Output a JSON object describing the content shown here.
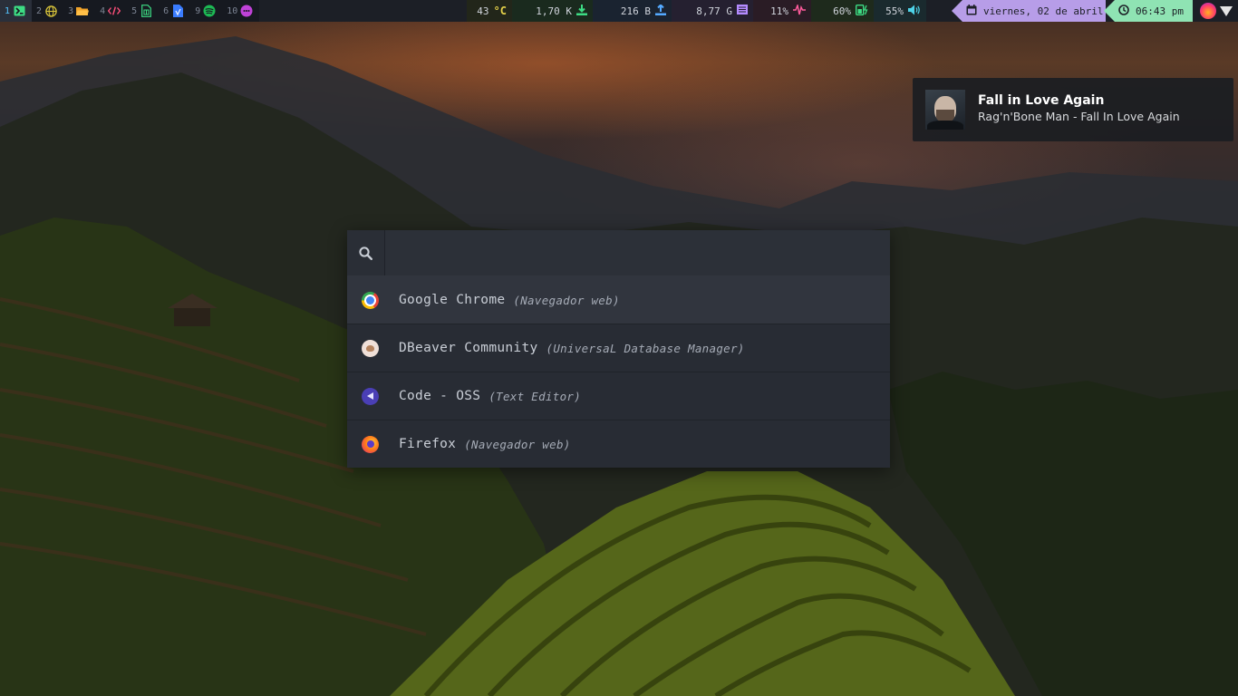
{
  "topbar": {
    "workspaces": [
      {
        "num": "1",
        "icon": "terminal-icon",
        "color": "#3ddc84",
        "active": true
      },
      {
        "num": "2",
        "icon": "globe-icon",
        "color": "#d6c23a"
      },
      {
        "num": "3",
        "icon": "folder-icon",
        "color": "#f0a32a"
      },
      {
        "num": "4",
        "icon": "code-icon",
        "color": "#ff4f7a"
      },
      {
        "num": "5",
        "icon": "spreadsheet-icon",
        "color": "#3ddc84"
      },
      {
        "num": "6",
        "icon": "document-icon",
        "color": "#3a7cff"
      },
      {
        "num": "9",
        "icon": "spotify-icon",
        "color": "#1db954"
      },
      {
        "num": "10",
        "icon": "chat-icon",
        "color": "#c042d8"
      }
    ],
    "stats": {
      "temperature": {
        "value": "43",
        "unit": "°C",
        "icon": "thermometer-icon",
        "color": "#e6d24a"
      },
      "download": {
        "value": "1,70 K",
        "icon": "download-icon",
        "color": "#3ddc84"
      },
      "upload": {
        "value": "216 B",
        "icon": "upload-icon",
        "color": "#54aaff"
      },
      "memory": {
        "value": "8,77 G",
        "icon": "memory-icon",
        "color": "#b48cff"
      },
      "cpu": {
        "value": "11%",
        "icon": "pulse-icon",
        "color": "#ff5b9c"
      },
      "battery": {
        "value": "60%",
        "icon": "battery-charging-icon",
        "color": "#3ddc84"
      },
      "volume": {
        "value": "55%",
        "icon": "volume-icon",
        "color": "#4fd3e8"
      }
    },
    "date": {
      "text": "viernes, 02 de abril",
      "icon": "calendar-icon",
      "bg": "#b79de8"
    },
    "time": {
      "text": "06:43 pm",
      "icon": "clock-icon",
      "bg": "#8fe3b3"
    },
    "tray": [
      {
        "icon": "firefox-dev-tray-icon"
      },
      {
        "icon": "wifi-icon"
      }
    ]
  },
  "notification": {
    "title": "Fall in Love Again",
    "body": "Rag'n'Bone Man - Fall In Love Again",
    "art": "album-art"
  },
  "launcher": {
    "search": {
      "value": "",
      "placeholder": "",
      "icon": "search-icon"
    },
    "results": [
      {
        "name": "Google Chrome",
        "description": "(Navegador web)",
        "icon": "chrome-icon",
        "selected": true
      },
      {
        "name": "DBeaver Community",
        "description": "(UniversaL Database Manager)",
        "icon": "dbeaver-icon"
      },
      {
        "name": "Code - OSS",
        "description": "(Text Editor)",
        "icon": "vscode-icon"
      },
      {
        "name": "Firefox",
        "description": "(Navegador web)",
        "icon": "firefox-icon"
      }
    ]
  }
}
